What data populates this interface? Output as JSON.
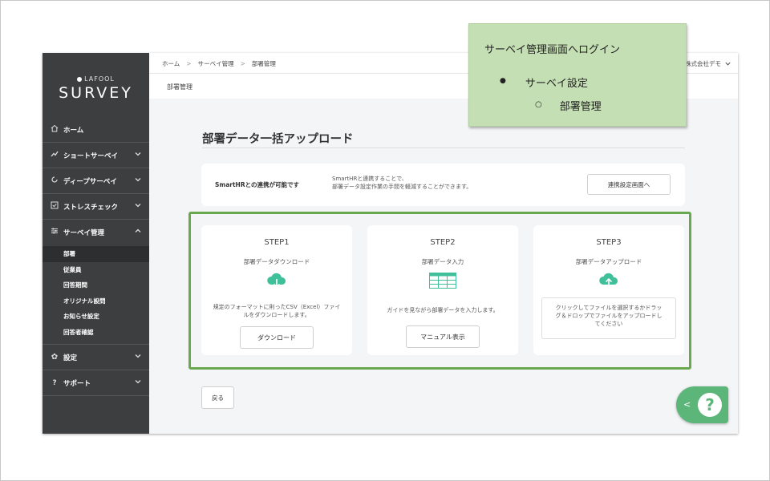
{
  "sidebar": {
    "logo_sub": "LAFOOL",
    "logo_main": "SURVEY",
    "items": [
      {
        "label": "ホーム",
        "icon": "home-icon"
      },
      {
        "label": "ショートサーベイ",
        "icon": "trend-icon"
      },
      {
        "label": "ディープサーベイ",
        "icon": "loop-icon"
      },
      {
        "label": "ストレスチェック",
        "icon": "check-box-icon"
      },
      {
        "label": "サーベイ管理",
        "icon": "sliders-icon"
      },
      {
        "label": "設定",
        "icon": "gear-icon"
      },
      {
        "label": "サポート",
        "icon": "question-icon"
      }
    ],
    "sub_items": [
      "部署",
      "従業員",
      "回答期間",
      "オリジナル設問",
      "お知らせ設定",
      "回答者確認"
    ]
  },
  "header": {
    "breadcrumbs": [
      "ホーム",
      "サーベイ管理",
      "部署管理"
    ],
    "company": "株式会社デモ",
    "page_label": "部署管理"
  },
  "main": {
    "title": "部署データ一括アップロード",
    "info": {
      "left": "SmartHRとの連携が可能です",
      "line1": "SmartHRと連携することで、",
      "line2": "部署データ設定作業の手間を軽減することができます。",
      "button": "連携設定画面へ"
    },
    "steps": [
      {
        "title": "STEP1",
        "subtitle": "部署データダウンロード",
        "desc1": "規定のフォーマットに則ったCSV（Excel）ファイ",
        "desc2": "ルをダウンロードします。",
        "button": "ダウンロード"
      },
      {
        "title": "STEP2",
        "subtitle": "部署データ入力",
        "desc1": "ガイドを見ながら部署データを入力します。",
        "button": "マニュアル表示"
      },
      {
        "title": "STEP3",
        "subtitle": "部署データアップロード",
        "drop1": "クリックしてファイルを選択するかドラッ",
        "drop2": "グ＆ドロップでファイルをアップロードし",
        "drop3": "てください"
      }
    ],
    "back": "戻る"
  },
  "note": {
    "title": "サーベイ管理画面へログイン",
    "bullet1": "●",
    "line1": "サーベイ設定",
    "bullet2": "○",
    "line2": "部署管理"
  },
  "colors": {
    "sidebar": "#3d3e40",
    "accent_green": "#6aa84f",
    "note_bg": "#c5dfb4",
    "icon_teal": "#3fbf9a",
    "help_green": "#5cb67a"
  }
}
